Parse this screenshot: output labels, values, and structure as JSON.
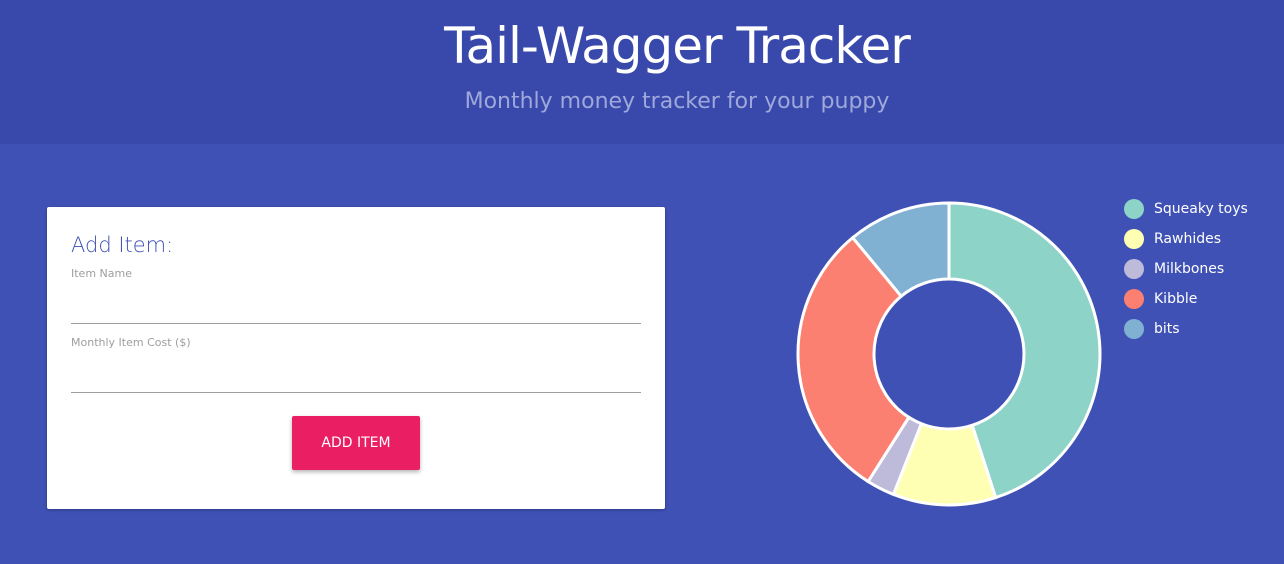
{
  "header": {
    "title": "Tail-Wagger Tracker",
    "subtitle": "Monthly money tracker for your puppy"
  },
  "form": {
    "title": "Add Item:",
    "item_name_label": "Item Name",
    "item_name_value": "",
    "cost_label": "Monthly Item Cost ($)",
    "cost_value": "",
    "add_button_label": "ADD ITEM"
  },
  "colors": {
    "header_bg": "#3949ab",
    "page_bg": "#3f51b5",
    "button_bg": "#e91e63"
  },
  "chart_data": {
    "type": "pie",
    "categories": [
      "Squeaky toys",
      "Rawhides",
      "Milkbones",
      "Kibble",
      "bits"
    ],
    "values": [
      45,
      11,
      3,
      30,
      11
    ],
    "colors": [
      "#8dd3c7",
      "#ffffb3",
      "#bebada",
      "#fb8072",
      "#80b1d3"
    ],
    "legend_position": "right"
  }
}
